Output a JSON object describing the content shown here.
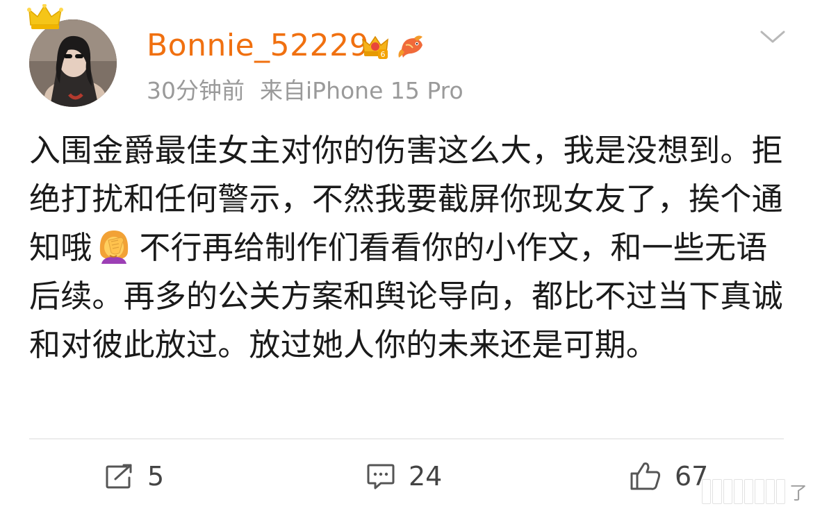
{
  "post": {
    "username": "Bonnie_52229",
    "time": "30分钟前",
    "source": "来自iPhone 15 Pro",
    "text_part1": "入围金爵最佳女主对你的伤害这么大，我是没想到。拒绝打扰和任何警示，不然我要截屏你现女友了，挨个通知哦",
    "emoji": "face-palm-emoji",
    "text_part2": "不行再给制作们看看你的小作文，和一些无语后续。再多的公关方案和舆论导向，都比不过当下真诚和对彼此放过。放过她人你的未来还是可期。",
    "badges": [
      "crown-level-badge",
      "koi-fish-badge"
    ]
  },
  "actions": {
    "repost_count": "5",
    "comment_count": "24",
    "like_count": "67"
  },
  "watermark": {
    "text": "了"
  },
  "colors": {
    "username": "#f07010",
    "meta": "#9a9a9a",
    "text": "#1a1a1a",
    "divider": "#ececec",
    "icons": "#555555"
  }
}
